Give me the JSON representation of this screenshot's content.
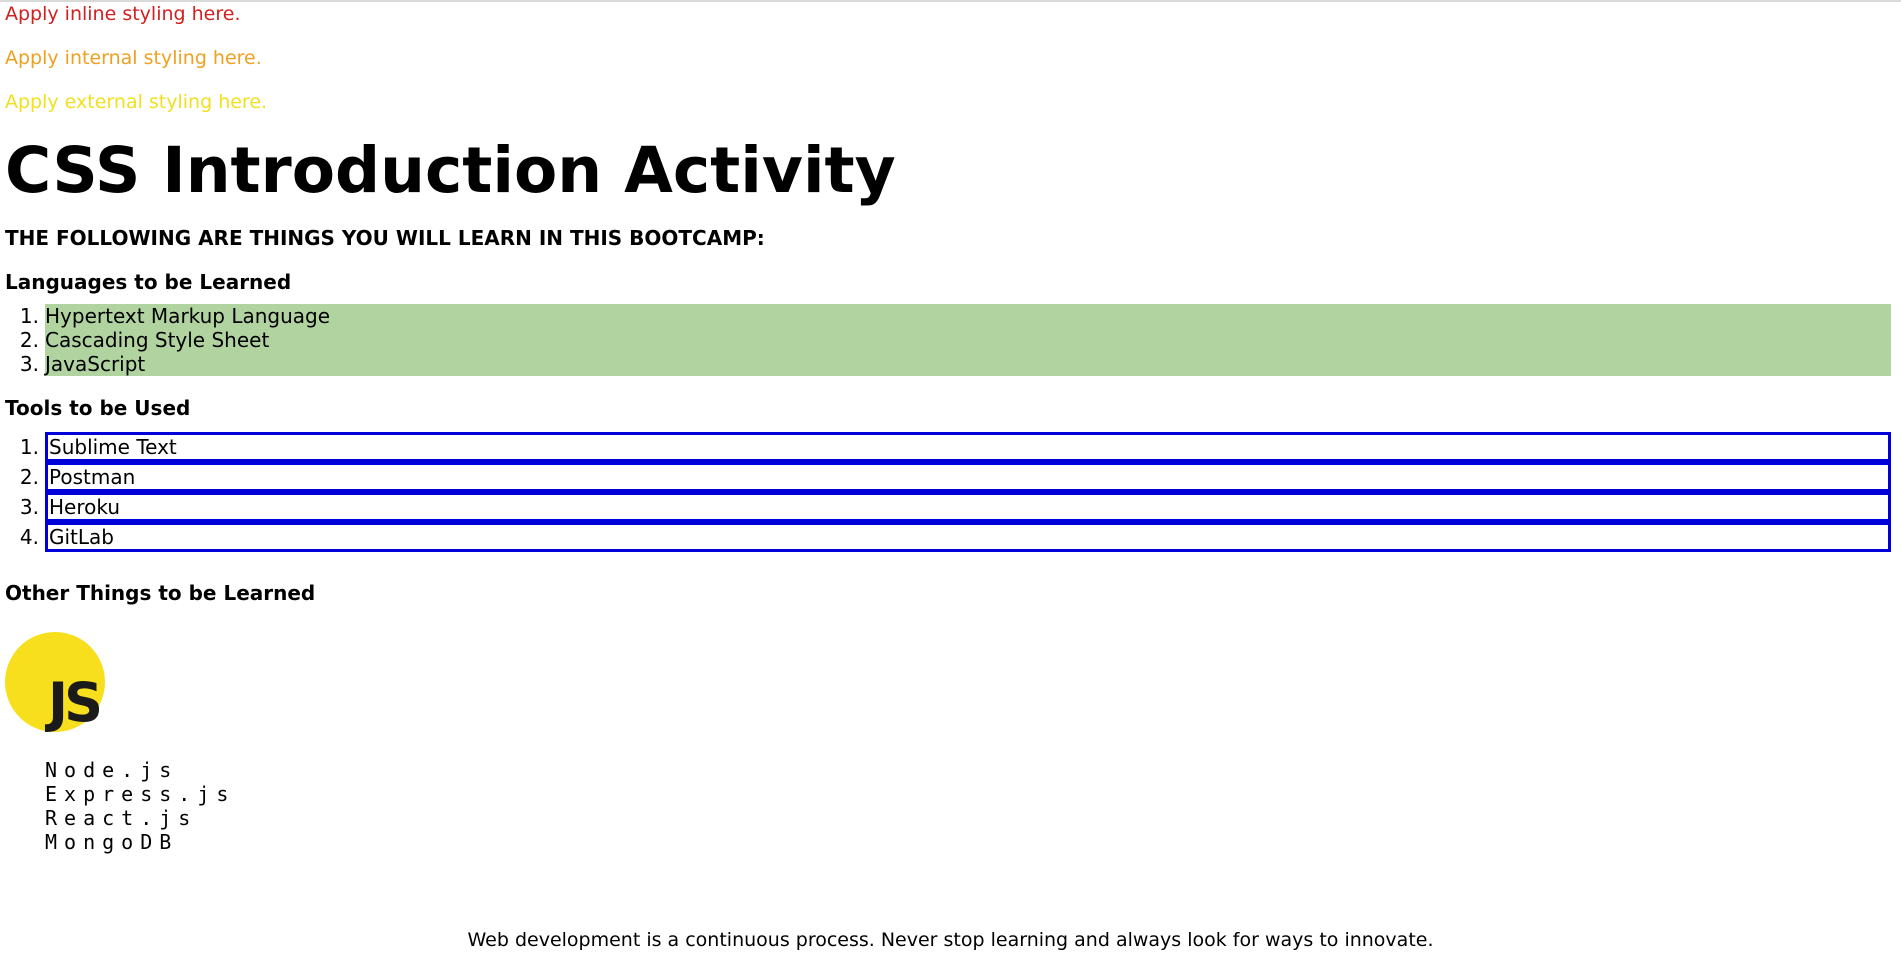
{
  "styling_examples": {
    "inline": {
      "text": "Apply inline styling here.",
      "color": "#d21f1f"
    },
    "internal": {
      "text": "Apply internal styling here.",
      "color": "#f0a020"
    },
    "external": {
      "text": "Apply external styling here.",
      "color": "#f0e020"
    }
  },
  "title": "CSS Introduction Activity",
  "subtitle": "THE FOLLOWING ARE THINGS YOU WILL LEARN IN THIS BOOTCAMP:",
  "languages": {
    "heading": "Languages to be Learned",
    "highlight_color": "#b0d3a0",
    "items": [
      {
        "num": "1.",
        "label": "Hypertext Markup Language"
      },
      {
        "num": "2.",
        "label": "Cascading Style Sheet"
      },
      {
        "num": "3.",
        "label": "JavaScript"
      }
    ]
  },
  "tools": {
    "heading": "Tools to be Used",
    "border_color": "#0000d9",
    "items": [
      {
        "num": "1.",
        "label": "Sublime Text"
      },
      {
        "num": "2.",
        "label": "Postman"
      },
      {
        "num": "3.",
        "label": "Heroku"
      },
      {
        "num": "4.",
        "label": "GitLab"
      }
    ]
  },
  "other": {
    "heading": "Other Things to be Learned",
    "logo": {
      "icon": "javascript-logo-icon",
      "text": "JS",
      "color": "#f7df1e"
    },
    "items": [
      "Node.js",
      "Express.js",
      "React.js",
      "MongoDB"
    ]
  },
  "footer": "Web development is a continuous process. Never stop learning and always look for ways to innovate."
}
